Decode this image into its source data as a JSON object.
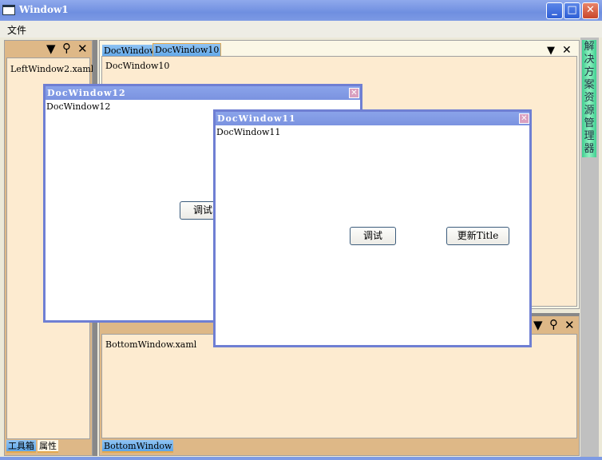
{
  "window": {
    "title": "Window1",
    "minimize": "_",
    "maximize": "□",
    "close": "✕"
  },
  "menu": {
    "items": [
      {
        "label": "文件"
      }
    ]
  },
  "left_pane": {
    "content": "LeftWindow2.xaml",
    "tabs": [
      {
        "label": "工具箱"
      },
      {
        "label": "属性"
      }
    ]
  },
  "doc_area": {
    "tabs": [
      {
        "label": "DocWindow1"
      },
      {
        "label": "DocWindow10"
      }
    ],
    "content": "DocWindow10"
  },
  "right_autohide": {
    "label": "解决方案资源管理器"
  },
  "bottom_pane": {
    "content": "BottomWindow.xaml",
    "tabs": [
      {
        "label": "BottomWindow"
      }
    ]
  },
  "float12": {
    "title": "DocWindow12",
    "content": "DocWindow12",
    "button": "调试"
  },
  "float11": {
    "title": "DocWindow11",
    "content": "DocWindow11",
    "debug_button": "调试",
    "update_button": "更新Title"
  },
  "icons": {
    "dropdown": "▼",
    "pin": "⚲",
    "close": "✕"
  }
}
